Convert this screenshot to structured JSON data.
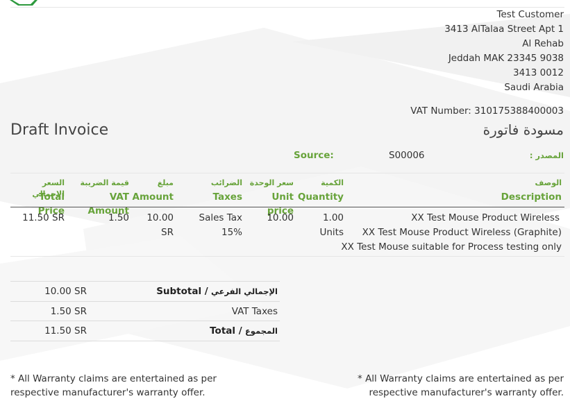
{
  "customer": {
    "name": "Test Customer",
    "street": "3413 AlTalaa Street Apt 1",
    "district": "Al Rehab",
    "city_line": "Jeddah MAK 23345 9038",
    "building": "3413 0012",
    "country": "Saudi Arabia",
    "vat_number": "VAT Number: 310175388400003"
  },
  "title": {
    "en": "Draft Invoice",
    "ar": "مسودة فاتورة"
  },
  "source": {
    "label": "Source:",
    "value": "S00006",
    "label_ar": "المصدر :"
  },
  "columns": {
    "total_price": {
      "ar": "السعر الاجمالي",
      "en": "Total Price"
    },
    "vat_amount": {
      "ar": "قيمة الضريبة",
      "en": "VAT Amount"
    },
    "amount": {
      "ar": "مبلغ",
      "en": "Amount"
    },
    "taxes": {
      "ar": "الضرائب",
      "en": "Taxes"
    },
    "unit_price": {
      "ar": "سعر الوحدة",
      "en": "Unit price"
    },
    "quantity": {
      "ar": "الكمية",
      "en": "Quantity"
    },
    "description": {
      "ar": "الوصف",
      "en": "Description"
    }
  },
  "line": {
    "total_price": "11.50 SR",
    "vat_amount": "1.50",
    "amount": "10.00 SR",
    "taxes": "Sales Tax 15%",
    "unit_price": "10.00",
    "quantity": "1.00 Units",
    "desc1": "XX Test Mouse Product Wireless",
    "desc2": "XX Test Mouse Product Wireless (Graphite)",
    "desc3": "XX Test Mouse suitable for Process testing only"
  },
  "totals": {
    "subtotal_value": "10.00 SR",
    "subtotal_label": "Subtotal /",
    "subtotal_ar": "الإجمالي الفرعي",
    "vat_value": "1.50 SR",
    "vat_label": "VAT Taxes",
    "total_value": "11.50 SR",
    "total_label": "Total /",
    "total_ar": "المجموع"
  },
  "warranty": {
    "left": "* All Warranty claims are entertained as per respective manufacturer's warranty offer.",
    "right": "* All Warranty claims are entertained as per respective manufacturer's warranty offer."
  },
  "colors": {
    "accent_green": "#67a33a",
    "logo_green": "#2e9a3e"
  },
  "icons": {
    "logo": "company-logo"
  }
}
